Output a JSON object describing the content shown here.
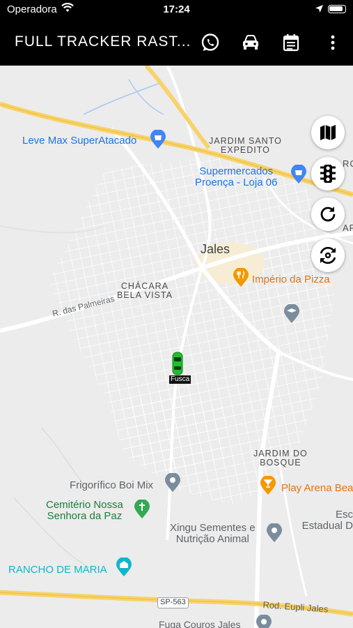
{
  "status_bar": {
    "carrier": "Operadora",
    "time": "17:24"
  },
  "app_bar": {
    "title": "FULL TRACKER RAST...",
    "actions": [
      "whatsapp-icon",
      "car-icon",
      "calendar-icon",
      "more-vert-icon"
    ]
  },
  "map": {
    "places": {
      "leve_max": "Leve Max SuperAtacado",
      "jardim_santo_1": "JARDIM SANTO",
      "jardim_santo_2": "EXPEDITO",
      "supermercados_1": "Supermercados",
      "supermercados_2": "Proença - Loja 06",
      "jales": "Jales",
      "imperio": "Império da Pizza",
      "chacara_1": "CHÁCARA",
      "chacara_2": "BELA VISTA",
      "rua_palmeiras": "R. das Palmeiras",
      "jardim_bosque_1": "JARDIM DO",
      "jardim_bosque_2": "BOSQUE",
      "frigorifico": "Frigorífico Boi Mix",
      "play_arena": "Play Arena Bea",
      "cemiterio_1": "Cemitério Nossa",
      "cemiterio_2": "Senhora da Paz",
      "xingu_1": "Xingu Sementes e",
      "xingu_2": "Nutrição Animal",
      "esc_1": "Esc",
      "esc_2": "Estadual D",
      "rancho": "RANCHO DE MARIA",
      "sp563": "SP-563",
      "rod_eupli": "Rod. Eupli Jales",
      "fuga_couros": "Fuga Couros Jales",
      "ro_1": "RO",
      "ro_2": "AR"
    },
    "vehicle": {
      "label": "Fusca",
      "color": "#1fbf2c"
    },
    "controls": [
      "map-type-icon",
      "traffic-light-icon",
      "refresh-icon",
      "auto-refresh-icon"
    ]
  }
}
